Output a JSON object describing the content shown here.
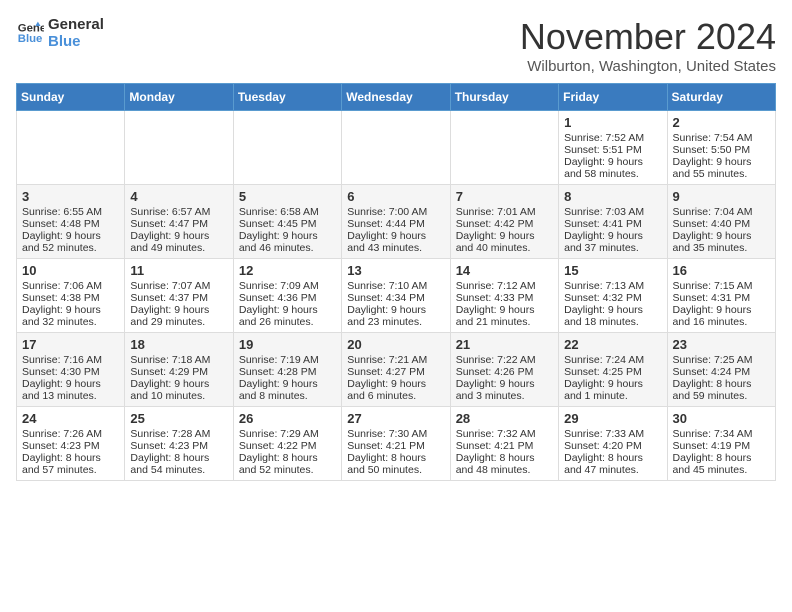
{
  "header": {
    "logo_line1": "General",
    "logo_line2": "Blue",
    "month": "November 2024",
    "location": "Wilburton, Washington, United States"
  },
  "weekdays": [
    "Sunday",
    "Monday",
    "Tuesday",
    "Wednesday",
    "Thursday",
    "Friday",
    "Saturday"
  ],
  "rows": [
    [
      {
        "day": "",
        "text": ""
      },
      {
        "day": "",
        "text": ""
      },
      {
        "day": "",
        "text": ""
      },
      {
        "day": "",
        "text": ""
      },
      {
        "day": "",
        "text": ""
      },
      {
        "day": "1",
        "text": "Sunrise: 7:52 AM\nSunset: 5:51 PM\nDaylight: 9 hours and 58 minutes."
      },
      {
        "day": "2",
        "text": "Sunrise: 7:54 AM\nSunset: 5:50 PM\nDaylight: 9 hours and 55 minutes."
      }
    ],
    [
      {
        "day": "3",
        "text": "Sunrise: 6:55 AM\nSunset: 4:48 PM\nDaylight: 9 hours and 52 minutes."
      },
      {
        "day": "4",
        "text": "Sunrise: 6:57 AM\nSunset: 4:47 PM\nDaylight: 9 hours and 49 minutes."
      },
      {
        "day": "5",
        "text": "Sunrise: 6:58 AM\nSunset: 4:45 PM\nDaylight: 9 hours and 46 minutes."
      },
      {
        "day": "6",
        "text": "Sunrise: 7:00 AM\nSunset: 4:44 PM\nDaylight: 9 hours and 43 minutes."
      },
      {
        "day": "7",
        "text": "Sunrise: 7:01 AM\nSunset: 4:42 PM\nDaylight: 9 hours and 40 minutes."
      },
      {
        "day": "8",
        "text": "Sunrise: 7:03 AM\nSunset: 4:41 PM\nDaylight: 9 hours and 37 minutes."
      },
      {
        "day": "9",
        "text": "Sunrise: 7:04 AM\nSunset: 4:40 PM\nDaylight: 9 hours and 35 minutes."
      }
    ],
    [
      {
        "day": "10",
        "text": "Sunrise: 7:06 AM\nSunset: 4:38 PM\nDaylight: 9 hours and 32 minutes."
      },
      {
        "day": "11",
        "text": "Sunrise: 7:07 AM\nSunset: 4:37 PM\nDaylight: 9 hours and 29 minutes."
      },
      {
        "day": "12",
        "text": "Sunrise: 7:09 AM\nSunset: 4:36 PM\nDaylight: 9 hours and 26 minutes."
      },
      {
        "day": "13",
        "text": "Sunrise: 7:10 AM\nSunset: 4:34 PM\nDaylight: 9 hours and 23 minutes."
      },
      {
        "day": "14",
        "text": "Sunrise: 7:12 AM\nSunset: 4:33 PM\nDaylight: 9 hours and 21 minutes."
      },
      {
        "day": "15",
        "text": "Sunrise: 7:13 AM\nSunset: 4:32 PM\nDaylight: 9 hours and 18 minutes."
      },
      {
        "day": "16",
        "text": "Sunrise: 7:15 AM\nSunset: 4:31 PM\nDaylight: 9 hours and 16 minutes."
      }
    ],
    [
      {
        "day": "17",
        "text": "Sunrise: 7:16 AM\nSunset: 4:30 PM\nDaylight: 9 hours and 13 minutes."
      },
      {
        "day": "18",
        "text": "Sunrise: 7:18 AM\nSunset: 4:29 PM\nDaylight: 9 hours and 10 minutes."
      },
      {
        "day": "19",
        "text": "Sunrise: 7:19 AM\nSunset: 4:28 PM\nDaylight: 9 hours and 8 minutes."
      },
      {
        "day": "20",
        "text": "Sunrise: 7:21 AM\nSunset: 4:27 PM\nDaylight: 9 hours and 6 minutes."
      },
      {
        "day": "21",
        "text": "Sunrise: 7:22 AM\nSunset: 4:26 PM\nDaylight: 9 hours and 3 minutes."
      },
      {
        "day": "22",
        "text": "Sunrise: 7:24 AM\nSunset: 4:25 PM\nDaylight: 9 hours and 1 minute."
      },
      {
        "day": "23",
        "text": "Sunrise: 7:25 AM\nSunset: 4:24 PM\nDaylight: 8 hours and 59 minutes."
      }
    ],
    [
      {
        "day": "24",
        "text": "Sunrise: 7:26 AM\nSunset: 4:23 PM\nDaylight: 8 hours and 57 minutes."
      },
      {
        "day": "25",
        "text": "Sunrise: 7:28 AM\nSunset: 4:23 PM\nDaylight: 8 hours and 54 minutes."
      },
      {
        "day": "26",
        "text": "Sunrise: 7:29 AM\nSunset: 4:22 PM\nDaylight: 8 hours and 52 minutes."
      },
      {
        "day": "27",
        "text": "Sunrise: 7:30 AM\nSunset: 4:21 PM\nDaylight: 8 hours and 50 minutes."
      },
      {
        "day": "28",
        "text": "Sunrise: 7:32 AM\nSunset: 4:21 PM\nDaylight: 8 hours and 48 minutes."
      },
      {
        "day": "29",
        "text": "Sunrise: 7:33 AM\nSunset: 4:20 PM\nDaylight: 8 hours and 47 minutes."
      },
      {
        "day": "30",
        "text": "Sunrise: 7:34 AM\nSunset: 4:19 PM\nDaylight: 8 hours and 45 minutes."
      }
    ]
  ]
}
